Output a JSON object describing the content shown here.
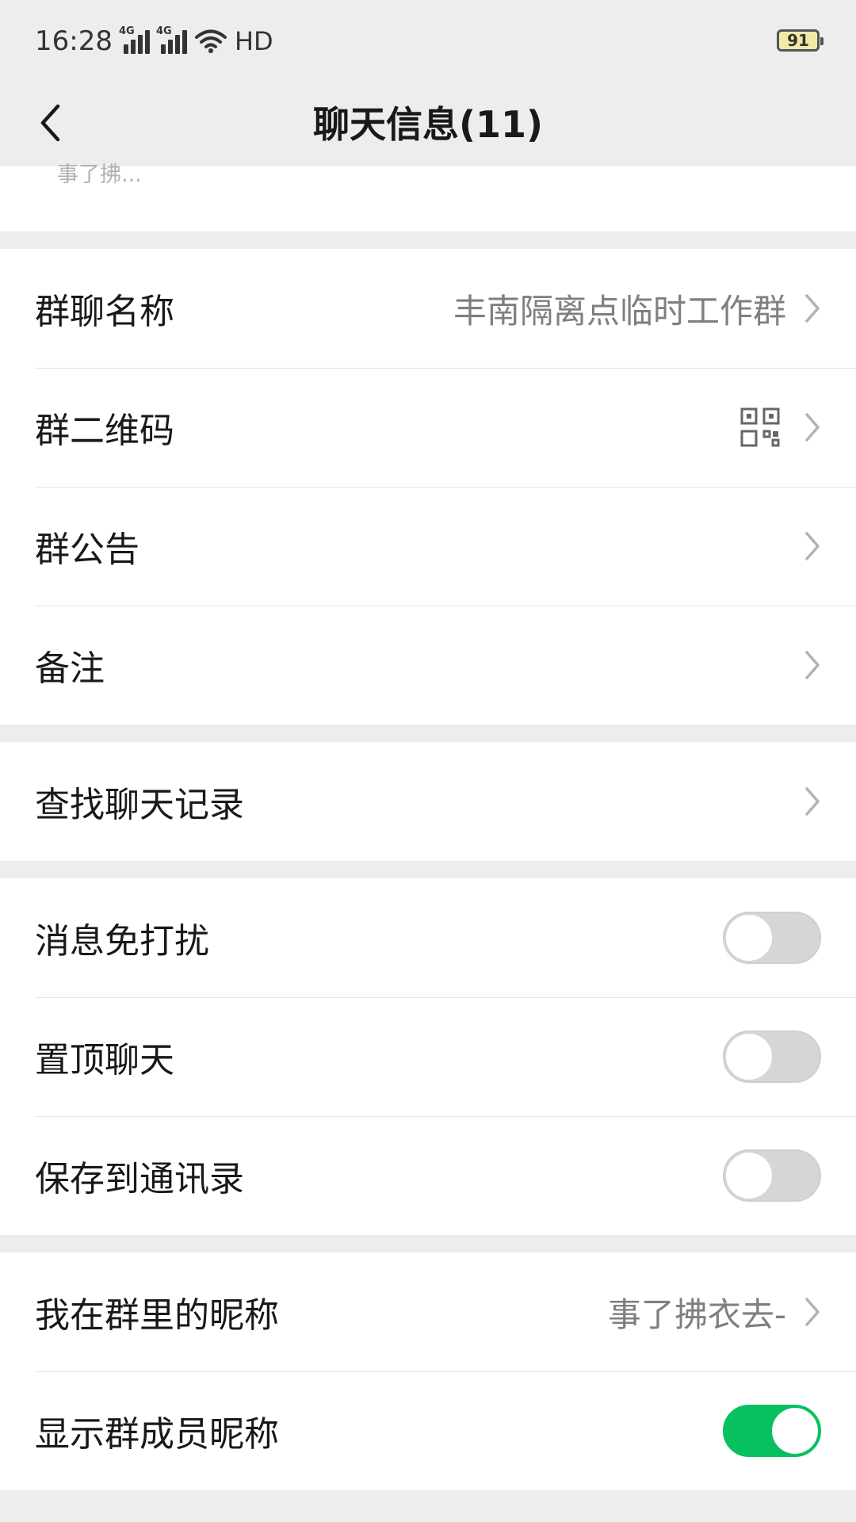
{
  "status_bar": {
    "time": "16:28",
    "network1": "4G",
    "network2": "4G",
    "hd_label": "HD",
    "battery": "91"
  },
  "header": {
    "back_icon": "chevron-left-icon",
    "title": "聊天信息(11)"
  },
  "members_peek_text": "事了拂...",
  "group_info": {
    "name_label": "群聊名称",
    "name_value": "丰南隔离点临时工作群",
    "qr_label": "群二维码",
    "qr_icon": "qr-code-icon",
    "announcement_label": "群公告",
    "remark_label": "备注"
  },
  "search": {
    "label": "查找聊天记录"
  },
  "toggles": {
    "mute_label": "消息免打扰",
    "mute_on": false,
    "pin_label": "置顶聊天",
    "pin_on": false,
    "save_contacts_label": "保存到通讯录",
    "save_contacts_on": false
  },
  "nickname": {
    "label": "我在群里的昵称",
    "value": "事了拂衣去-",
    "show_member_nicknames_label": "显示群成员昵称",
    "show_member_nicknames_on": true
  },
  "colors": {
    "accent_green": "#07c160",
    "background": "#ededed"
  }
}
